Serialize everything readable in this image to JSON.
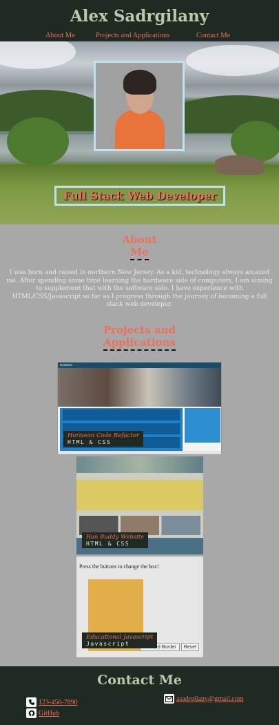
{
  "header": {
    "title": "Alex Sadrgilany",
    "nav": [
      "About Me",
      "Projects and Applications",
      "Contact Me"
    ]
  },
  "hero": {
    "tagline": "Full Stack Web Developer"
  },
  "about": {
    "heading_line1": "About",
    "heading_line2": "Me",
    "text": "I was born and raised in northern New Jersey. As a kid, technology always amazed me. After spending some time learning the hardware side of computers, I am aiming to supplement that with the software side. I have experience with HTML/CSS/Javascript so far as I progress through the journey of becoming a full stack web developer."
  },
  "projects": {
    "heading_line1": "Projects and",
    "heading_line2": "Applications",
    "items": [
      {
        "title": "Horiseon Code Refactor",
        "stack": "HTML & CSS"
      },
      {
        "title": "Run Buddy Website",
        "stack": "HTML & CSS"
      },
      {
        "title": "Educational Javascript",
        "stack": "Javascript"
      }
    ],
    "card1_brand": "Horiseon",
    "card3_text": "Press the buttons to change the box!",
    "card3_buttons": [
      "t Dotted Border",
      "Reset"
    ]
  },
  "contact": {
    "heading": "Contact Me",
    "phone": "123-456-7890",
    "github": "GitHub",
    "email": "asadrgilany@gmail.com"
  },
  "colors": {
    "header_bg": "#1f2a22",
    "accent": "#ee6f5a",
    "title": "#b9c9aa",
    "page_bg": "#a8a8a8",
    "frame": "#bfe3ee"
  },
  "icons": [
    "phone-icon",
    "github-icon",
    "email-icon"
  ]
}
